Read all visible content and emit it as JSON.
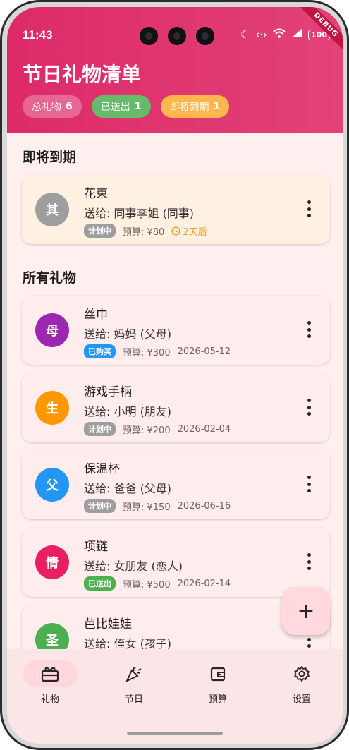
{
  "status_bar": {
    "time": "11:43",
    "battery": "100",
    "debug_banner": "DEBUG"
  },
  "header": {
    "title": "节日礼物清单",
    "chips": [
      {
        "label": "总礼物",
        "count": "6"
      },
      {
        "label": "已送出",
        "count": "1"
      },
      {
        "label": "即将到期",
        "count": "1"
      }
    ]
  },
  "sections": {
    "upcoming": "即将到期",
    "all": "所有礼物"
  },
  "upcoming": [
    {
      "avatar": "其",
      "color": "#9e9e9e",
      "name": "花束",
      "recipient": "送给:  同事李姐 (同事)",
      "status": "计划中",
      "status_color": "#9e9e9e",
      "budget": "预算: ¥80",
      "countdown": "2天后"
    }
  ],
  "gifts": [
    {
      "avatar": "母",
      "color": "#9c27b0",
      "name": "丝巾",
      "recipient": "送给:  妈妈 (父母)",
      "status": "已购买",
      "status_color": "#2196f3",
      "budget": "预算: ¥300",
      "date": "2026-05-12"
    },
    {
      "avatar": "生",
      "color": "#ff9800",
      "name": "游戏手柄",
      "recipient": "送给:  小明 (朋友)",
      "status": "计划中",
      "status_color": "#9e9e9e",
      "budget": "预算: ¥200",
      "date": "2026-02-04"
    },
    {
      "avatar": "父",
      "color": "#2196f3",
      "name": "保温杯",
      "recipient": "送给:  爸爸 (父母)",
      "status": "计划中",
      "status_color": "#9e9e9e",
      "budget": "预算: ¥150",
      "date": "2026-06-16"
    },
    {
      "avatar": "情",
      "color": "#e91e63",
      "name": "项链",
      "recipient": "送给:  女朋友 (恋人)",
      "status": "已送出",
      "status_color": "#4caf50",
      "budget": "预算: ¥500",
      "date": "2026-02-14"
    },
    {
      "avatar": "圣",
      "color": "#4caf50",
      "name": "芭比娃娃",
      "recipient": "送给:  侄女 (孩子)"
    }
  ],
  "fab": {
    "icon": "plus-icon",
    "label": "+"
  },
  "nav": [
    {
      "label": "礼物",
      "icon": "gift-icon",
      "active": true
    },
    {
      "label": "节日",
      "icon": "party-popper-icon"
    },
    {
      "label": "预算",
      "icon": "wallet-icon"
    },
    {
      "label": "设置",
      "icon": "gear-icon"
    }
  ]
}
